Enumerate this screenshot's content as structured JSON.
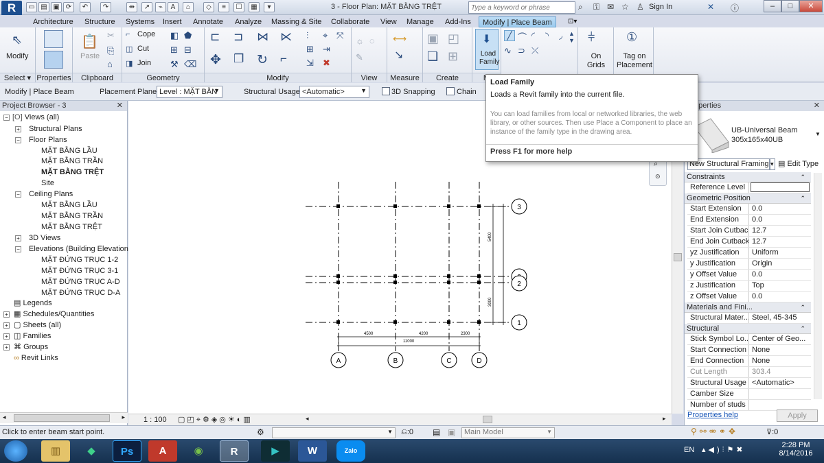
{
  "app": {
    "logo": "R",
    "document_title": "3 - Floor Plan: MẶT BẰNG TRỆT"
  },
  "search": {
    "placeholder": "Type a keyword or phrase"
  },
  "account": {
    "sign_in": "Sign In"
  },
  "ribbon_tabs": [
    "Architecture",
    "Structure",
    "Systems",
    "Insert",
    "Annotate",
    "Analyze",
    "Massing & Site",
    "Collaborate",
    "View",
    "Manage",
    "Add-Ins",
    "Modify | Place Beam"
  ],
  "ribbon": {
    "modify": "Modify",
    "paste": "Paste",
    "cope": "Cope",
    "cut": "Cut",
    "join": "Join",
    "load_family": "Load Family",
    "on_grids": "On Grids",
    "tag_on_placement": "Tag on Placement",
    "panels": {
      "select": "Select",
      "properties": "Properties",
      "clipboard": "Clipboard",
      "geometry": "Geometry",
      "modify": "Modify",
      "view": "View",
      "measure": "Measure",
      "create": "Create",
      "mode": "M"
    }
  },
  "options_bar": {
    "mode_label": "Modify | Place Beam",
    "placement_plane_label": "Placement Plane:",
    "placement_plane_value": "Level : MẶT BẰN",
    "structural_usage_label": "Structural Usage:",
    "structural_usage_value": "<Automatic>",
    "snapping_label": "3D Snapping",
    "chain_label": "Chain"
  },
  "tooltip": {
    "title": "Load Family",
    "description": "Loads a Revit family into the current file.",
    "detail": "You can load families from local or networked libraries, the web library, or other sources. Then use Place a Component to place an instance of the family type in the drawing area.",
    "help": "Press F1 for more help"
  },
  "project_browser": {
    "title": "Project Browser - 3",
    "nodes": [
      "Views (all)",
      "Structural Plans",
      "Floor Plans",
      "MẶT BẰNG LẦU",
      "MẶT BẰNG TRẦN",
      "MẶT BẰNG TRỆT",
      "Site",
      "Ceiling Plans",
      "MẶT BẰNG LẦU",
      "MẶT BẰNG TRẦN",
      "MẶT BẰNG TRỆT",
      "3D Views",
      "Elevations (Building Elevation",
      "MẶT ĐỨNG TRỤC 1-2",
      "MẶT ĐỨNG TRỤC 3-1",
      "MẶT ĐỨNG TRỤC A-D",
      "MẶT ĐỨNG TRỤC D-A",
      "Legends",
      "Schedules/Quantities",
      "Sheets (all)",
      "Families",
      "Groups",
      "Revit Links"
    ]
  },
  "properties": {
    "title": "Properties",
    "type_name": "UB-Universal Beam",
    "type_size": "305x165x40UB",
    "instance_selector": "New Structural Framing",
    "edit_type": "Edit Type",
    "groups": [
      "Constraints",
      "Geometric Position",
      "Materials and Fini...",
      "Structural"
    ],
    "rows": [
      {
        "k": "Reference Level",
        "v": ""
      },
      {
        "k": "Start Extension",
        "v": "0.0"
      },
      {
        "k": "End Extension",
        "v": "0.0"
      },
      {
        "k": "Start Join Cutback",
        "v": "12.7"
      },
      {
        "k": "End Join Cutback",
        "v": "12.7"
      },
      {
        "k": "yz Justification",
        "v": "Uniform"
      },
      {
        "k": "y Justification",
        "v": "Origin"
      },
      {
        "k": "y Offset Value",
        "v": "0.0"
      },
      {
        "k": "z Justification",
        "v": "Top"
      },
      {
        "k": "z Offset Value",
        "v": "0.0"
      },
      {
        "k": "Structural Mater...",
        "v": "Steel, 45-345"
      },
      {
        "k": "Stick Symbol Lo...",
        "v": "Center of Geo..."
      },
      {
        "k": "Start Connection",
        "v": "None"
      },
      {
        "k": "End Connection",
        "v": "None"
      },
      {
        "k": "Cut Length",
        "v": "303.4"
      },
      {
        "k": "Structural Usage",
        "v": "<Automatic>"
      },
      {
        "k": "Camber Size",
        "v": ""
      },
      {
        "k": "Number of studs",
        "v": ""
      }
    ],
    "help_link": "Properties help",
    "apply": "Apply"
  },
  "drawing": {
    "grid_bubbles": [
      "A",
      "B",
      "C",
      "D",
      "3",
      "2",
      "2",
      "1"
    ],
    "dims_bottom": [
      "4500",
      "4200",
      "2300"
    ],
    "dims_total": "11000",
    "dims_side": [
      "5400",
      "3000"
    ]
  },
  "view_bar": {
    "scale": "1 : 100"
  },
  "status": {
    "message": "Click to enter beam start point.",
    "workset": ":0",
    "model": "Main Model",
    "filter": ":0"
  },
  "taskbar": {
    "lang": "EN",
    "time": "2:28 PM",
    "date": "8/14/2016",
    "apps": [
      "Ps",
      "W",
      "Zalo"
    ]
  },
  "colors": {
    "accent": "#1d4f8f",
    "context_tab": "#9ccbee",
    "taskbar": "#1f3b5c"
  }
}
